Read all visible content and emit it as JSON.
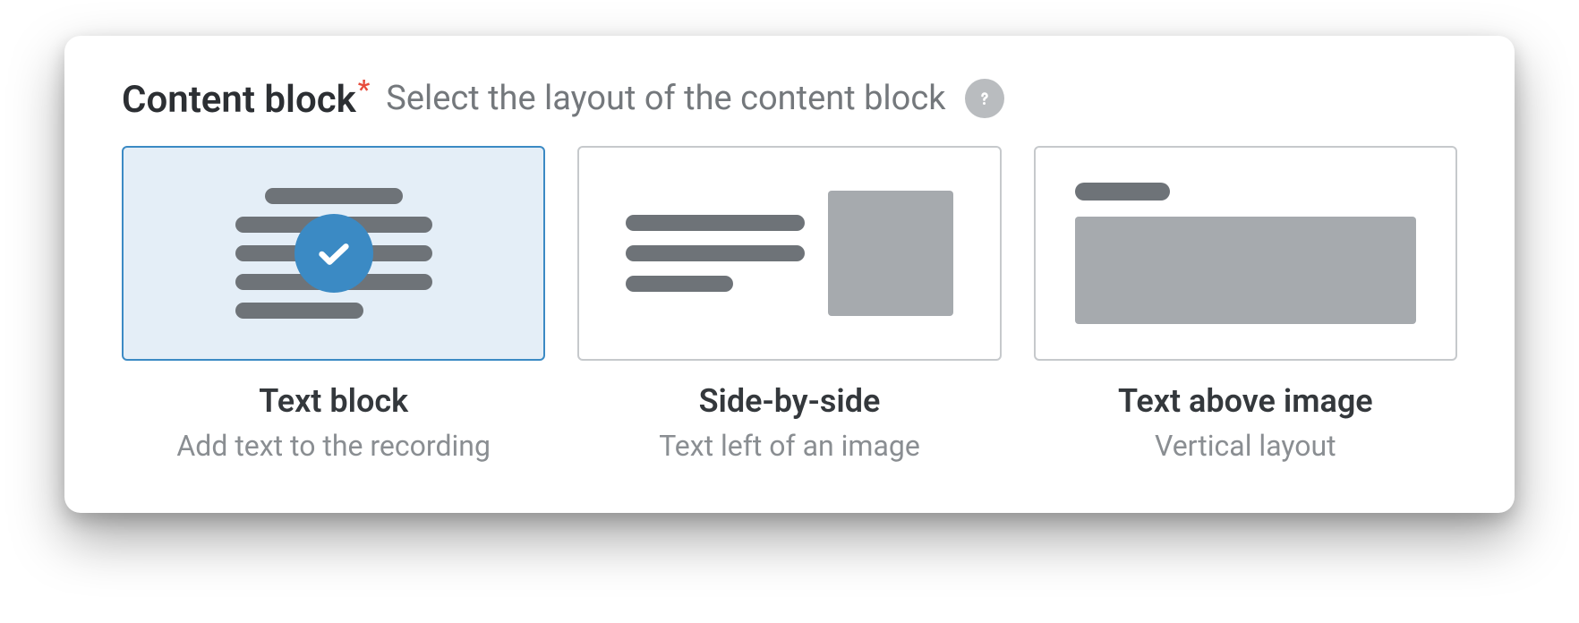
{
  "header": {
    "title": "Content block",
    "required_marker": "*",
    "subtitle": "Select the layout of the content block"
  },
  "options": [
    {
      "id": "text-block",
      "title": "Text block",
      "description": "Add text to the recording",
      "selected": true
    },
    {
      "id": "side-by-side",
      "title": "Side-by-side",
      "description": "Text left of an image",
      "selected": false
    },
    {
      "id": "text-above-image",
      "title": "Text above image",
      "description": "Vertical layout",
      "selected": false
    }
  ],
  "colors": {
    "accent": "#3b8ac4",
    "text_primary": "#2c2f33",
    "text_secondary": "#8a8e92",
    "required": "#e74c3c"
  }
}
